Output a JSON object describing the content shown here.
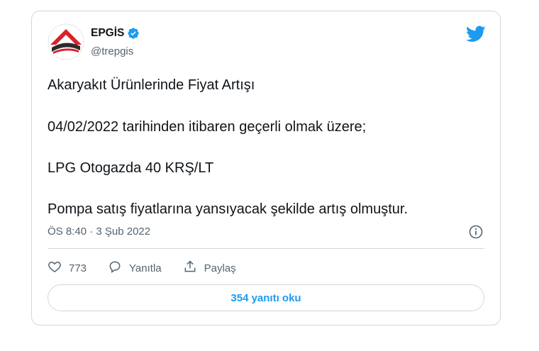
{
  "author": {
    "display_name": "EPGİS",
    "handle": "@trepgis",
    "verified": true
  },
  "tweet": {
    "lines": [
      "Akaryakıt Ürünlerinde Fiyat Artışı",
      "04/02/2022 tarihinden itibaren geçerli olmak üzere;",
      "LPG Otogazda 40 KRŞ/LT",
      "Pompa satış fiyatlarına yansıyacak şekilde artış olmuştur."
    ],
    "timestamp": "ÖS 8:40 · 3 Şub 2022"
  },
  "actions": {
    "like_count": "773",
    "reply_label": "Yanıtla",
    "share_label": "Paylaş"
  },
  "read_replies_label": "354 yanıtı oku",
  "colors": {
    "accent": "#1d9bf0",
    "text": "#0f1419",
    "muted": "#536471",
    "border": "#cfd9de",
    "logo_red": "#d8222a"
  },
  "icons": {
    "brand": "twitter-bird-icon",
    "verified": "verified-badge-icon",
    "info": "info-icon",
    "like": "heart-icon",
    "reply": "speech-bubble-icon",
    "share": "share-upload-icon"
  }
}
